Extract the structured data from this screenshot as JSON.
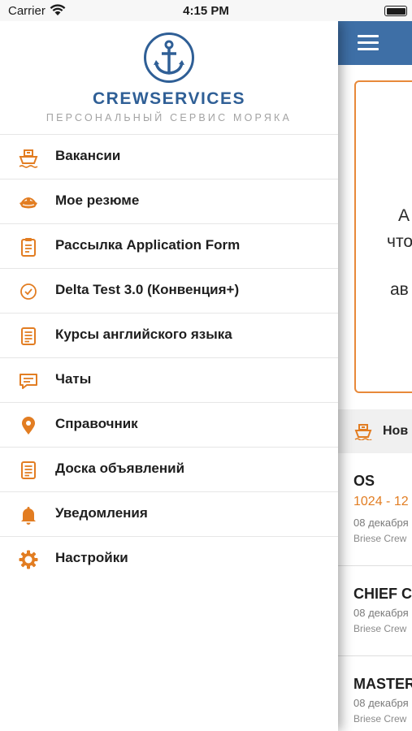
{
  "status_bar": {
    "carrier": "Carrier",
    "time": "4:15 PM"
  },
  "brand": {
    "name": "CREWSERVICES",
    "subtitle": "ПЕРСОНАЛЬНЫЙ СЕРВИС МОРЯКА",
    "logo_icon": "anchor-icon",
    "brand_color": "#2f5f96"
  },
  "menu": {
    "accent_color": "#e27d22",
    "items": [
      {
        "label": "Вакансии",
        "icon": "ship-icon"
      },
      {
        "label": "Мое резюме",
        "icon": "sailor-cap-icon"
      },
      {
        "label": "Рассылка Application Form",
        "icon": "clipboard-icon"
      },
      {
        "label": "Delta Test 3.0 (Конвенция+)",
        "icon": "check-circle-icon"
      },
      {
        "label": "Курсы английского языка",
        "icon": "document-icon"
      },
      {
        "label": "Чаты",
        "icon": "chat-icon"
      },
      {
        "label": "Справочник",
        "icon": "map-pin-icon"
      },
      {
        "label": "Доска объявлений",
        "icon": "document-icon"
      },
      {
        "label": "Уведомления",
        "icon": "bell-icon"
      },
      {
        "label": "Настройки",
        "icon": "gear-icon"
      }
    ]
  },
  "main": {
    "navbar_color": "#3e6fa6",
    "promo_lines": [
      "А",
      "что",
      "ав"
    ],
    "section_title": "Нов",
    "jobs": [
      {
        "title": "OS",
        "salary": "1024 - 12",
        "date": "08 декабря",
        "company": "Briese Crew"
      },
      {
        "title": "CHIEF C",
        "salary": "",
        "date": "08 декабря",
        "company": "Briese Crew"
      },
      {
        "title": "MASTER",
        "salary": "",
        "date": "08 декабря",
        "company": "Briese Crew"
      }
    ]
  }
}
